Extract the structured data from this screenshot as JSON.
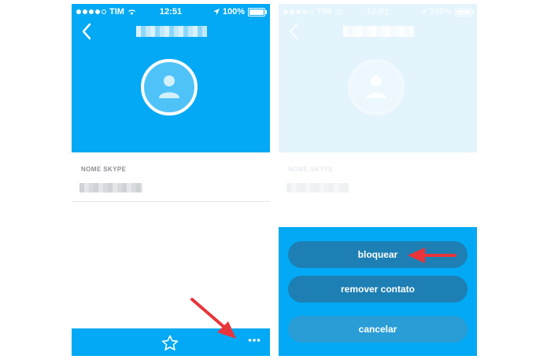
{
  "statusbar": {
    "carrier": "TIM",
    "time": "12:51",
    "battery": "100%"
  },
  "profile": {
    "field_label": "NOME SKYPE"
  },
  "sheet": {
    "block_label": "bloquear",
    "remove_label": "remover contato",
    "cancel_label": "cancelar"
  },
  "colors": {
    "accent": "#03a9f4",
    "button_dark": "#1d7fb3",
    "arrow": "#e8353b"
  },
  "icons": [
    "back-chevron-icon",
    "wifi-icon",
    "location-icon",
    "battery-icon",
    "avatar-person-icon",
    "star-icon",
    "more-dots-icon",
    "annotation-arrow-icon"
  ]
}
